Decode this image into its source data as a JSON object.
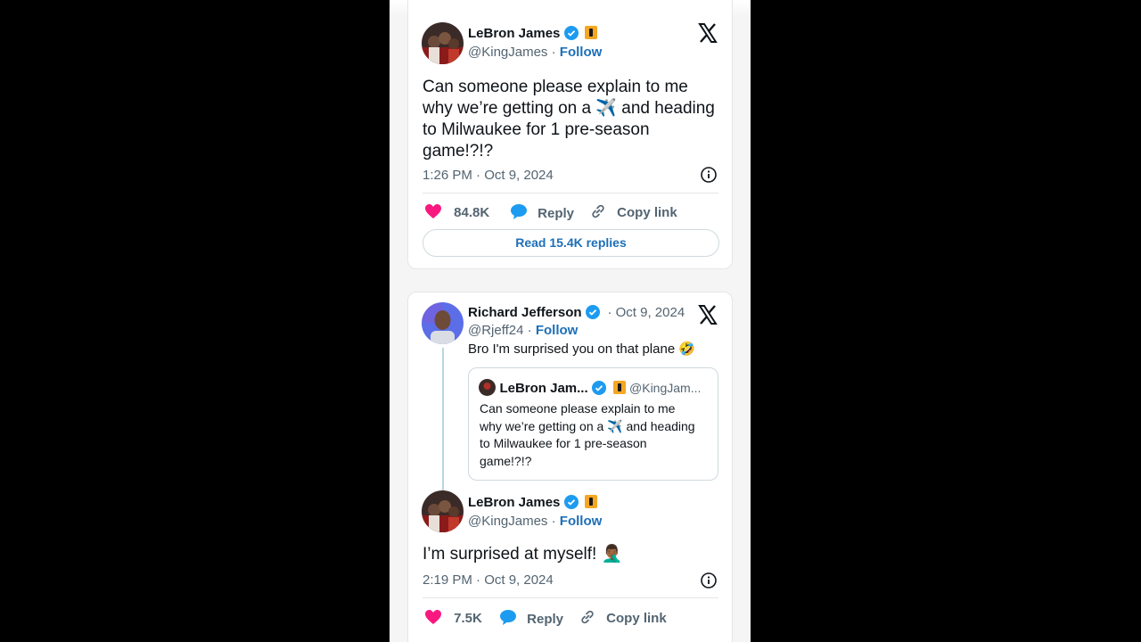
{
  "colors": {
    "accent": "#1d6fb8",
    "like": "#f91880",
    "reply_icon": "#1d9bf0",
    "background": "#000000",
    "text": "#0f1419",
    "muted": "#536471"
  },
  "tweet1": {
    "name": "LeBron James",
    "handle": "@KingJames",
    "separator": "·",
    "follow": "Follow",
    "text": "Can someone please explain to me why we’re getting on a ✈️ and heading to Milwaukee for 1 pre-season game!?!?",
    "time": "1:26 PM · Oct 9, 2024",
    "likes": "84.8K",
    "reply": "Reply",
    "copy_link": "Copy link",
    "read_replies": "Read 15.4K replies"
  },
  "tweet2": {
    "name": "Richard Jefferson",
    "date": "· Oct 9, 2024",
    "handle": "@Rjeff24",
    "separator": "·",
    "follow": "Follow",
    "text": "Bro I'm surprised you on that plane 🤣",
    "quote": {
      "name": "LeBron Jam...",
      "handle": "@KingJam...",
      "text": "Can someone please explain to me why we’re getting on a ✈️ and heading to Milwaukee for 1 pre-season game!?!?"
    }
  },
  "tweet3": {
    "name": "LeBron James",
    "handle": "@KingJames",
    "separator": "·",
    "follow": "Follow",
    "text": "I’m surprised at myself! 🤦🏾‍♂️",
    "time": "2:19 PM · Oct 9, 2024",
    "likes": "7.5K",
    "reply": "Reply",
    "copy_link": "Copy link"
  },
  "icons": [
    "verified-badge-icon",
    "flame-emoji-icon",
    "x-logo-icon",
    "info-icon",
    "heart-icon",
    "reply-bubble-icon",
    "link-icon"
  ]
}
